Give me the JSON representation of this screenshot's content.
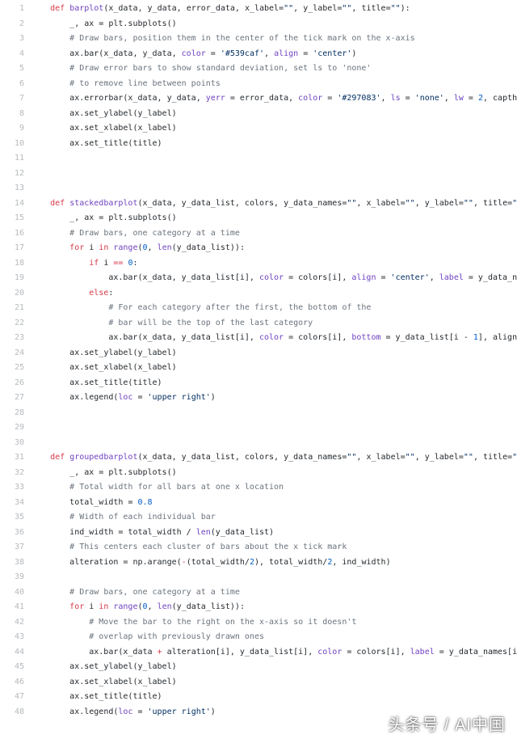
{
  "watermark": "头条号 / AI中国",
  "lines": [
    {
      "n": 1,
      "indent": 1,
      "tokens": [
        [
          "kw",
          "def "
        ],
        [
          "fn",
          "barplot"
        ],
        [
          "",
          "(x_data, y_data, error_data, x_label="
        ],
        [
          "str",
          "\"\""
        ],
        [
          "",
          ", y_label="
        ],
        [
          "str",
          "\"\""
        ],
        [
          "",
          ", title="
        ],
        [
          "str",
          "\"\""
        ],
        [
          "",
          "):"
        ]
      ]
    },
    {
      "n": 2,
      "indent": 2,
      "tokens": [
        [
          "",
          "_, ax = plt.subplots()"
        ]
      ]
    },
    {
      "n": 3,
      "indent": 2,
      "tokens": [
        [
          "cm",
          "# Draw bars, position them in the center of the tick mark on the x-axis"
        ]
      ]
    },
    {
      "n": 4,
      "indent": 2,
      "tokens": [
        [
          "",
          "ax.bar(x_data, y_data, "
        ],
        [
          "fn",
          "color"
        ],
        [
          "",
          " = "
        ],
        [
          "str",
          "'#539caf'"
        ],
        [
          "",
          ", "
        ],
        [
          "fn",
          "align"
        ],
        [
          "",
          " = "
        ],
        [
          "str",
          "'center'"
        ],
        [
          "",
          ")"
        ]
      ]
    },
    {
      "n": 5,
      "indent": 2,
      "tokens": [
        [
          "cm",
          "# Draw error bars to show standard deviation, set ls to 'none'"
        ]
      ]
    },
    {
      "n": 6,
      "indent": 2,
      "tokens": [
        [
          "cm",
          "# to remove line between points"
        ]
      ]
    },
    {
      "n": 7,
      "indent": 2,
      "tokens": [
        [
          "",
          "ax.errorbar(x_data, y_data, "
        ],
        [
          "fn",
          "yerr"
        ],
        [
          "",
          " = error_data, "
        ],
        [
          "fn",
          "color"
        ],
        [
          "",
          " = "
        ],
        [
          "str",
          "'#297083'"
        ],
        [
          "",
          ", "
        ],
        [
          "fn",
          "ls"
        ],
        [
          "",
          " = "
        ],
        [
          "str",
          "'none'"
        ],
        [
          "",
          ", "
        ],
        [
          "fn",
          "lw"
        ],
        [
          "",
          " = "
        ],
        [
          "num",
          "2"
        ],
        [
          "",
          ", capth"
        ]
      ]
    },
    {
      "n": 8,
      "indent": 2,
      "tokens": [
        [
          "",
          "ax.set_ylabel(y_label)"
        ]
      ]
    },
    {
      "n": 9,
      "indent": 2,
      "tokens": [
        [
          "",
          "ax.set_xlabel(x_label)"
        ]
      ]
    },
    {
      "n": 10,
      "indent": 2,
      "tokens": [
        [
          "",
          "ax.set_title(title)"
        ]
      ]
    },
    {
      "n": 11,
      "indent": 0,
      "tokens": []
    },
    {
      "n": 12,
      "indent": 0,
      "tokens": []
    },
    {
      "n": 13,
      "indent": 0,
      "tokens": []
    },
    {
      "n": 14,
      "indent": 1,
      "tokens": [
        [
          "kw",
          "def "
        ],
        [
          "fn",
          "stackedbarplot"
        ],
        [
          "",
          "(x_data, y_data_list, colors, y_data_names="
        ],
        [
          "str",
          "\"\""
        ],
        [
          "",
          ", x_label="
        ],
        [
          "str",
          "\"\""
        ],
        [
          "",
          ", y_label="
        ],
        [
          "str",
          "\"\""
        ],
        [
          "",
          ", title="
        ],
        [
          "str",
          "\""
        ]
      ]
    },
    {
      "n": 15,
      "indent": 2,
      "tokens": [
        [
          "",
          "_, ax = plt.subplots()"
        ]
      ]
    },
    {
      "n": 16,
      "indent": 2,
      "tokens": [
        [
          "cm",
          "# Draw bars, one category at a time"
        ]
      ]
    },
    {
      "n": 17,
      "indent": 2,
      "tokens": [
        [
          "kw",
          "for"
        ],
        [
          "",
          " i "
        ],
        [
          "kw",
          "in"
        ],
        [
          "",
          " "
        ],
        [
          "fn",
          "range"
        ],
        [
          "",
          "("
        ],
        [
          "num",
          "0"
        ],
        [
          "",
          ", "
        ],
        [
          "fn",
          "len"
        ],
        [
          "",
          "(y_data_list)):"
        ]
      ]
    },
    {
      "n": 18,
      "indent": 3,
      "tokens": [
        [
          "kw",
          "if"
        ],
        [
          "",
          " i "
        ],
        [
          "kw",
          "=="
        ],
        [
          "",
          " "
        ],
        [
          "num",
          "0"
        ],
        [
          "",
          ":"
        ]
      ]
    },
    {
      "n": 19,
      "indent": 4,
      "tokens": [
        [
          "",
          "ax.bar(x_data, y_data_list[i], "
        ],
        [
          "fn",
          "color"
        ],
        [
          "",
          " = colors[i], "
        ],
        [
          "fn",
          "align"
        ],
        [
          "",
          " = "
        ],
        [
          "str",
          "'center'"
        ],
        [
          "",
          ", "
        ],
        [
          "fn",
          "label"
        ],
        [
          "",
          " = y_data_na"
        ]
      ]
    },
    {
      "n": 20,
      "indent": 3,
      "tokens": [
        [
          "kw",
          "else"
        ],
        [
          "",
          ":"
        ]
      ]
    },
    {
      "n": 21,
      "indent": 4,
      "tokens": [
        [
          "cm",
          "# For each category after the first, the bottom of the"
        ]
      ]
    },
    {
      "n": 22,
      "indent": 4,
      "tokens": [
        [
          "cm",
          "# bar will be the top of the last category"
        ]
      ]
    },
    {
      "n": 23,
      "indent": 4,
      "tokens": [
        [
          "",
          "ax.bar(x_data, y_data_list[i], "
        ],
        [
          "fn",
          "color"
        ],
        [
          "",
          " = colors[i], "
        ],
        [
          "fn",
          "bottom"
        ],
        [
          "",
          " = y_data_list[i - "
        ],
        [
          "num",
          "1"
        ],
        [
          "",
          "], align"
        ]
      ]
    },
    {
      "n": 24,
      "indent": 2,
      "tokens": [
        [
          "",
          "ax.set_ylabel(y_label)"
        ]
      ]
    },
    {
      "n": 25,
      "indent": 2,
      "tokens": [
        [
          "",
          "ax.set_xlabel(x_label)"
        ]
      ]
    },
    {
      "n": 26,
      "indent": 2,
      "tokens": [
        [
          "",
          "ax.set_title(title)"
        ]
      ]
    },
    {
      "n": 27,
      "indent": 2,
      "tokens": [
        [
          "",
          "ax.legend("
        ],
        [
          "fn",
          "loc"
        ],
        [
          "",
          " = "
        ],
        [
          "str",
          "'upper right'"
        ],
        [
          "",
          ")"
        ]
      ]
    },
    {
      "n": 28,
      "indent": 0,
      "tokens": []
    },
    {
      "n": 29,
      "indent": 0,
      "tokens": []
    },
    {
      "n": 30,
      "indent": 0,
      "tokens": []
    },
    {
      "n": 31,
      "indent": 1,
      "tokens": [
        [
          "kw",
          "def "
        ],
        [
          "fn",
          "groupedbarplot"
        ],
        [
          "",
          "(x_data, y_data_list, colors, y_data_names="
        ],
        [
          "str",
          "\"\""
        ],
        [
          "",
          ", x_label="
        ],
        [
          "str",
          "\"\""
        ],
        [
          "",
          ", y_label="
        ],
        [
          "str",
          "\"\""
        ],
        [
          "",
          ", title="
        ],
        [
          "str",
          "\""
        ]
      ]
    },
    {
      "n": 32,
      "indent": 2,
      "tokens": [
        [
          "",
          "_, ax = plt.subplots()"
        ]
      ]
    },
    {
      "n": 33,
      "indent": 2,
      "tokens": [
        [
          "cm",
          "# Total width for all bars at one x location"
        ]
      ]
    },
    {
      "n": 34,
      "indent": 2,
      "tokens": [
        [
          "",
          "total_width = "
        ],
        [
          "num",
          "0.8"
        ]
      ]
    },
    {
      "n": 35,
      "indent": 2,
      "tokens": [
        [
          "cm",
          "# Width of each individual bar"
        ]
      ]
    },
    {
      "n": 36,
      "indent": 2,
      "tokens": [
        [
          "",
          "ind_width = total_width / "
        ],
        [
          "fn",
          "len"
        ],
        [
          "",
          "(y_data_list)"
        ]
      ]
    },
    {
      "n": 37,
      "indent": 2,
      "tokens": [
        [
          "cm",
          "# This centers each cluster of bars about the x tick mark"
        ]
      ]
    },
    {
      "n": 38,
      "indent": 2,
      "tokens": [
        [
          "",
          "alteration = np.arange("
        ],
        [
          "kw",
          "-"
        ],
        [
          "",
          "(total_width/"
        ],
        [
          "num",
          "2"
        ],
        [
          "",
          "), total_width/"
        ],
        [
          "num",
          "2"
        ],
        [
          "",
          ", ind_width)"
        ]
      ]
    },
    {
      "n": 39,
      "indent": 0,
      "tokens": []
    },
    {
      "n": 40,
      "indent": 2,
      "tokens": [
        [
          "cm",
          "# Draw bars, one category at a time"
        ]
      ]
    },
    {
      "n": 41,
      "indent": 2,
      "tokens": [
        [
          "kw",
          "for"
        ],
        [
          "",
          " i "
        ],
        [
          "kw",
          "in"
        ],
        [
          "",
          " "
        ],
        [
          "fn",
          "range"
        ],
        [
          "",
          "("
        ],
        [
          "num",
          "0"
        ],
        [
          "",
          ", "
        ],
        [
          "fn",
          "len"
        ],
        [
          "",
          "(y_data_list)):"
        ]
      ]
    },
    {
      "n": 42,
      "indent": 3,
      "tokens": [
        [
          "cm",
          "# Move the bar to the right on the x-axis so it doesn't"
        ]
      ]
    },
    {
      "n": 43,
      "indent": 3,
      "tokens": [
        [
          "cm",
          "# overlap with previously drawn ones"
        ]
      ]
    },
    {
      "n": 44,
      "indent": 3,
      "tokens": [
        [
          "",
          "ax.bar(x_data "
        ],
        [
          "kw",
          "+"
        ],
        [
          "",
          " alteration[i], y_data_list[i], "
        ],
        [
          "fn",
          "color"
        ],
        [
          "",
          " = colors[i], "
        ],
        [
          "fn",
          "label"
        ],
        [
          "",
          " = y_data_names[i]"
        ]
      ]
    },
    {
      "n": 45,
      "indent": 2,
      "tokens": [
        [
          "",
          "ax.set_ylabel(y_label)"
        ]
      ]
    },
    {
      "n": 46,
      "indent": 2,
      "tokens": [
        [
          "",
          "ax.set_xlabel(x_label)"
        ]
      ]
    },
    {
      "n": 47,
      "indent": 2,
      "tokens": [
        [
          "",
          "ax.set_title(title)"
        ]
      ]
    },
    {
      "n": 48,
      "indent": 2,
      "tokens": [
        [
          "",
          "ax.legend("
        ],
        [
          "fn",
          "loc"
        ],
        [
          "",
          " = "
        ],
        [
          "str",
          "'upper right'"
        ],
        [
          "",
          ")"
        ]
      ]
    }
  ]
}
